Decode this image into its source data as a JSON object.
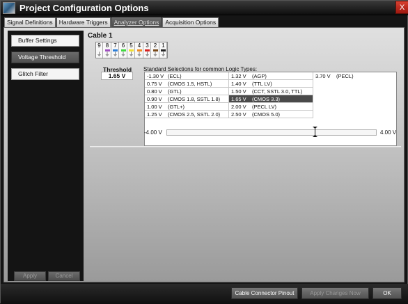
{
  "window": {
    "title": "Project Configuration Options",
    "close_label": "X"
  },
  "tabs": [
    {
      "label": "Signal Definitions"
    },
    {
      "label": "Hardware Triggers"
    },
    {
      "label": "Analyzer Options"
    },
    {
      "label": "Acquisition Options"
    }
  ],
  "active_tab": 2,
  "sidebar": {
    "items": [
      {
        "label": "Buffer Settings"
      },
      {
        "label": "Voltage Threshold"
      },
      {
        "label": "Glitch Filter"
      }
    ],
    "selected": 1,
    "apply_label": "Apply",
    "cancel_label": "Cancel"
  },
  "content": {
    "title": "Cable 1",
    "pins": [
      {
        "num": "9",
        "color": ""
      },
      {
        "num": "8",
        "color": "#a04fc0"
      },
      {
        "num": "7",
        "color": "#2e7fd8"
      },
      {
        "num": "6",
        "color": "#40d840"
      },
      {
        "num": "5",
        "color": "#f0e030"
      },
      {
        "num": "4",
        "color": "#f08a20"
      },
      {
        "num": "3",
        "color": "#d82020"
      },
      {
        "num": "2",
        "color": "#7a4a1a"
      },
      {
        "num": "1",
        "color": "#222222"
      }
    ],
    "threshold_label": "Threshold",
    "threshold_value": "1.65 V",
    "std_label": "Standard Selections for common Logic Types:",
    "selections": [
      [
        {
          "v": "-1.30 V",
          "t": "(ECL)"
        },
        {
          "v": "0.75 V",
          "t": "(CMOS 1.5, HSTL)"
        },
        {
          "v": "0.80 V",
          "t": "(GTL)"
        },
        {
          "v": "0.90 V",
          "t": "(CMOS 1.8, SSTL 1.8)"
        },
        {
          "v": "1.00 V",
          "t": "(GTL+)"
        },
        {
          "v": "1.25 V",
          "t": "(CMOS 2.5, SSTL 2.0)"
        }
      ],
      [
        {
          "v": "1.32 V",
          "t": "(AGP)"
        },
        {
          "v": "1.40 V",
          "t": "(TTL LV)"
        },
        {
          "v": "1.50 V",
          "t": "(CCT, SSTL 3.0, TTL)"
        },
        {
          "v": "1.65 V",
          "t": "(CMOS 3.3)"
        },
        {
          "v": "2.00 V",
          "t": "(PECL LV)"
        },
        {
          "v": "2.50 V",
          "t": "(CMOS 5.0)"
        }
      ],
      [
        {
          "v": "3.70 V",
          "t": "(PECL)"
        }
      ]
    ],
    "selected_cell": [
      1,
      3
    ],
    "slider": {
      "min_label": "-4.00 V",
      "max_label": "4.00 V",
      "min": -4,
      "max": 4,
      "value": 1.65
    }
  },
  "footer": {
    "cable_label": "Cable Connector Pinout",
    "apply_changes_label": "Apply Changes Now",
    "ok_label": "OK"
  }
}
